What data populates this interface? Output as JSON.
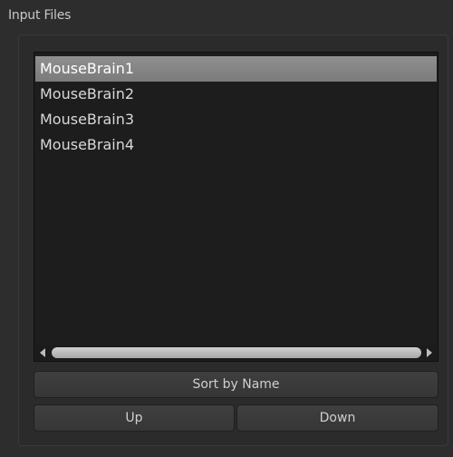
{
  "group": {
    "title": "Input Files"
  },
  "file_list": {
    "items": [
      {
        "label": "MouseBrain1",
        "selected": true
      },
      {
        "label": "MouseBrain2",
        "selected": false
      },
      {
        "label": "MouseBrain3",
        "selected": false
      },
      {
        "label": "MouseBrain4",
        "selected": false
      }
    ]
  },
  "buttons": {
    "sort_label": "Sort by Name",
    "up_label": "Up",
    "down_label": "Down"
  },
  "icons": {
    "scroll_left": "scroll-left-arrow-icon",
    "scroll_right": "scroll-right-arrow-icon"
  },
  "colors": {
    "background": "#2d2d2d",
    "list_background": "#1d1d1d",
    "selection": "#858585",
    "text": "#d8d8d8"
  }
}
